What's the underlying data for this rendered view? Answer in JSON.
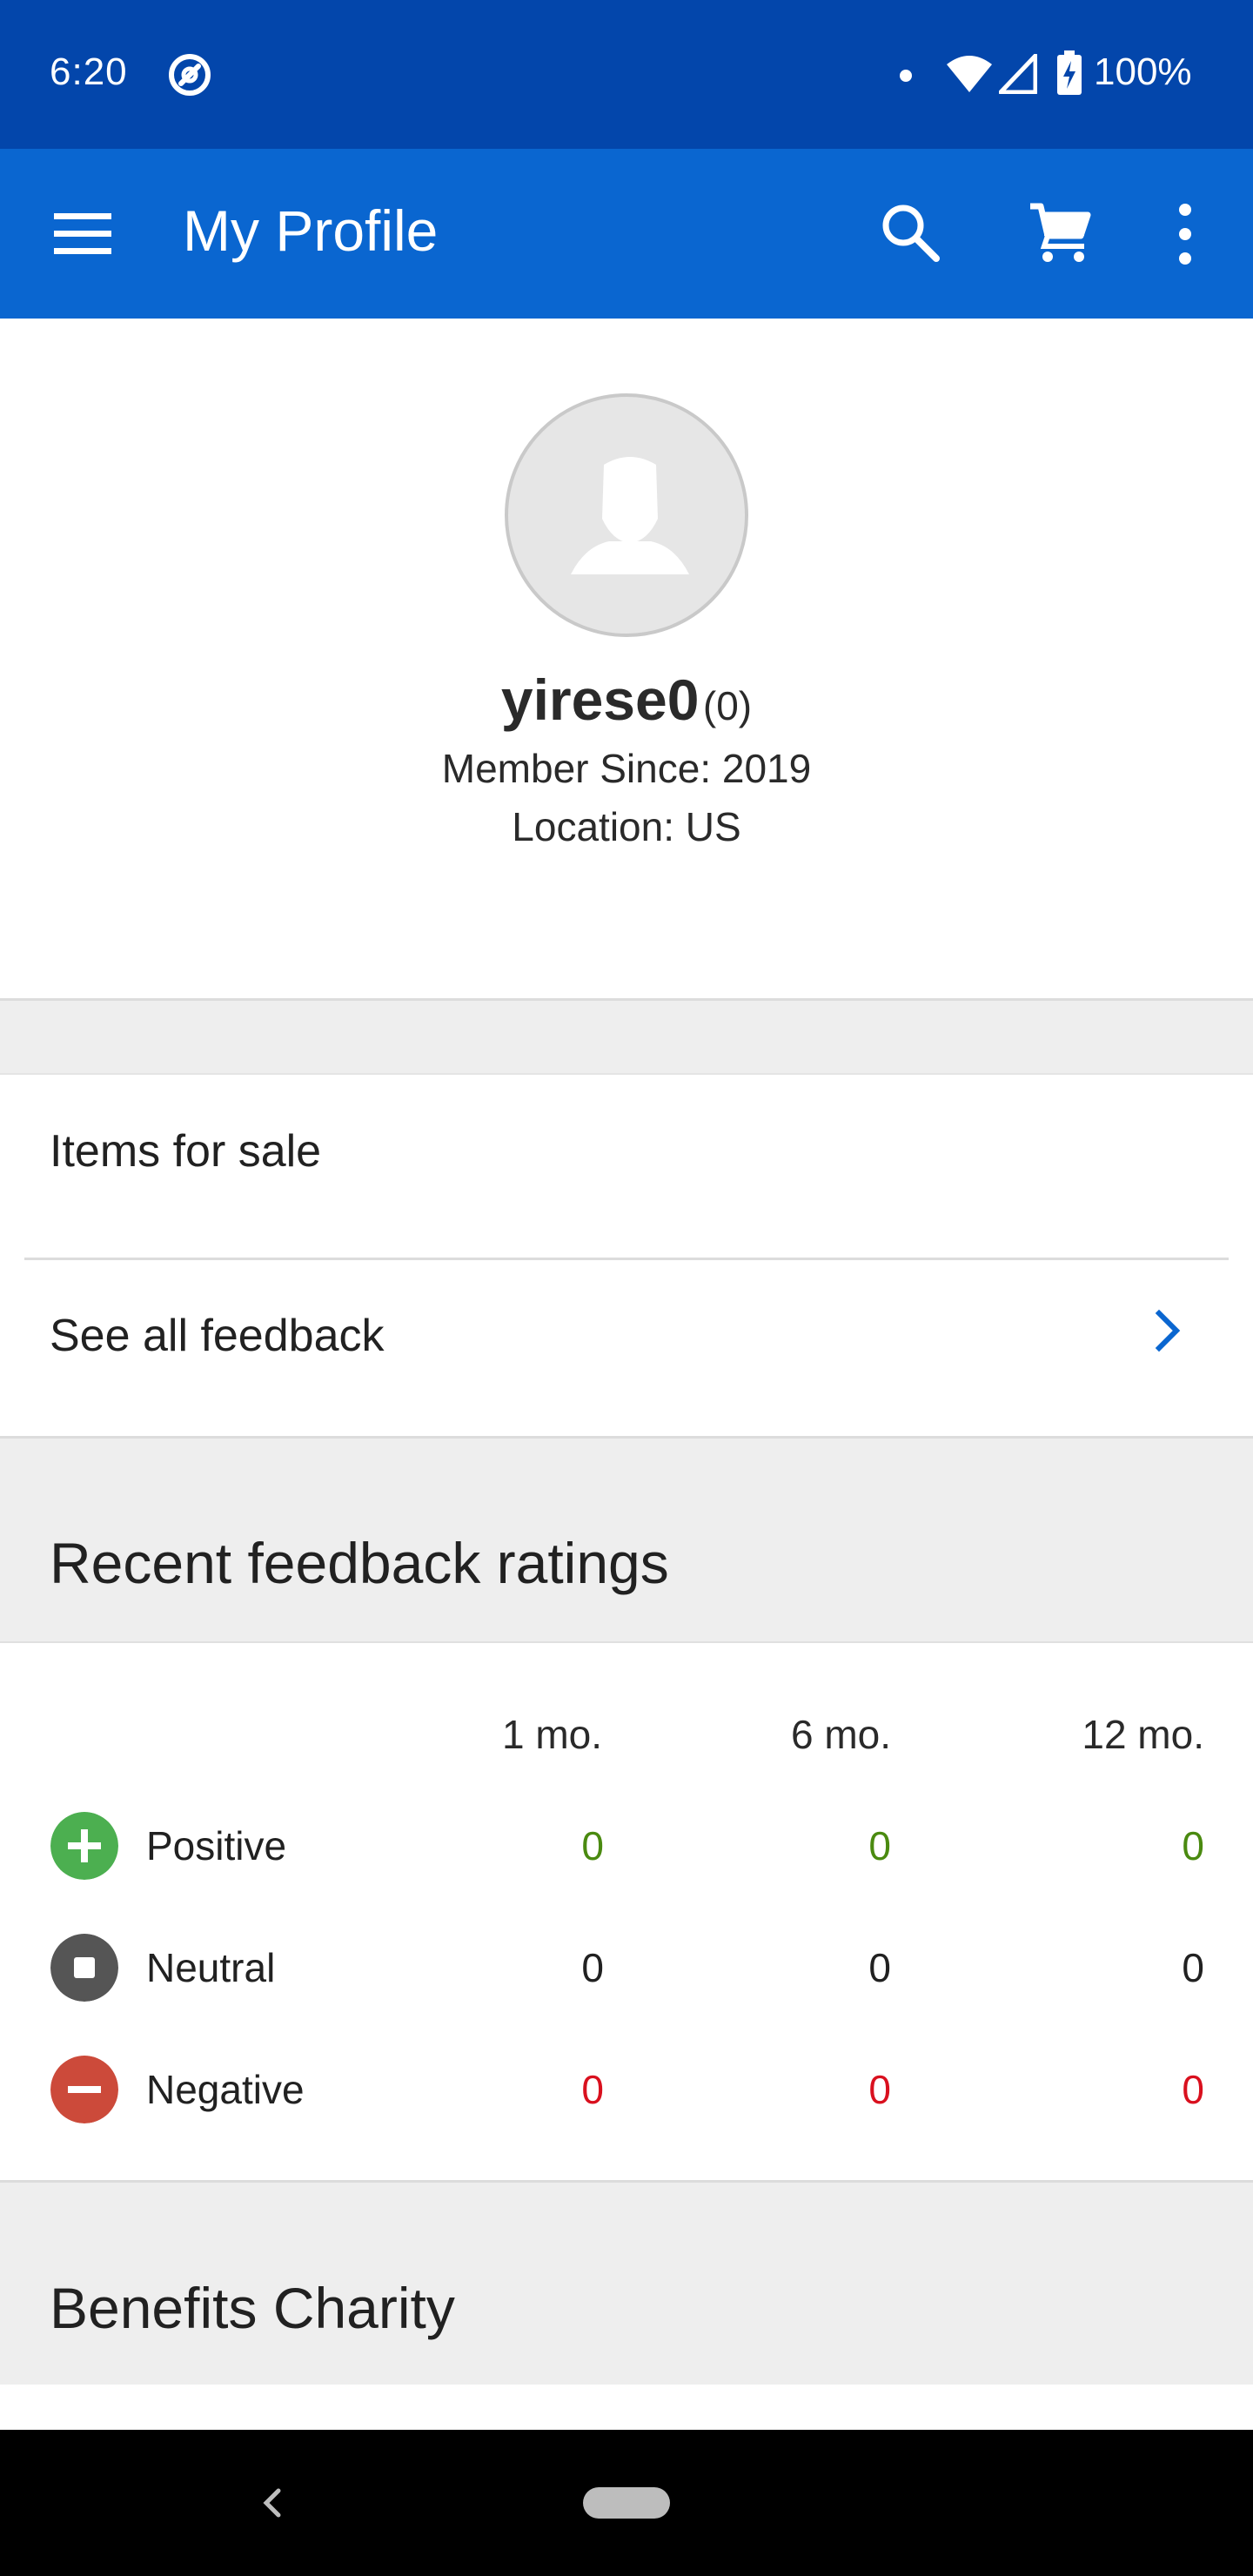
{
  "status_bar": {
    "time": "6:20",
    "battery": "100%",
    "icons": [
      "app-notification-icon",
      "dot-icon",
      "wifi-icon",
      "signal-icon",
      "battery-charging-icon"
    ]
  },
  "app_bar": {
    "title": "My Profile",
    "icons": [
      "menu-icon",
      "search-icon",
      "cart-icon",
      "more-vert-icon"
    ],
    "color": "#0a66d0"
  },
  "profile": {
    "username": "yirese0",
    "feedback_score": "(0)",
    "member_since": "Member Since: 2019",
    "location": "Location: US"
  },
  "links": {
    "items_for_sale": "Items for sale",
    "see_all_feedback": "See all feedback"
  },
  "feedback": {
    "header": "Recent feedback ratings",
    "columns": [
      "1 mo.",
      "6 mo.",
      "12 mo."
    ],
    "rows": [
      {
        "label": "Positive",
        "values": [
          "0",
          "0",
          "0"
        ],
        "color": "#4a8a10",
        "icon": "plus-circle-icon"
      },
      {
        "label": "Neutral",
        "values": [
          "0",
          "0",
          "0"
        ],
        "color": "#212121",
        "icon": "square-circle-icon"
      },
      {
        "label": "Negative",
        "values": [
          "0",
          "0",
          "0"
        ],
        "color": "#d9101e",
        "icon": "minus-circle-icon"
      }
    ]
  },
  "charity": {
    "header": "Benefits Charity"
  }
}
